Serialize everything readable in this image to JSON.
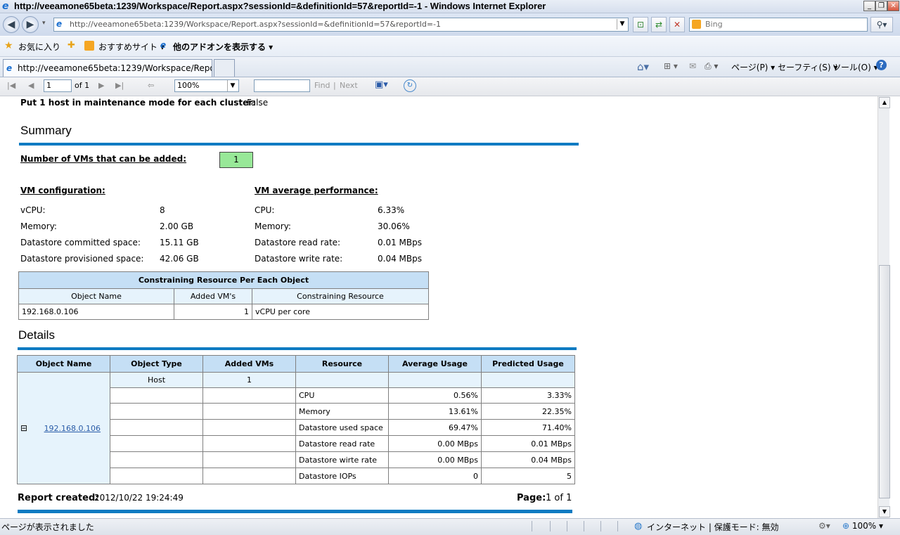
{
  "window": {
    "title": "http://veeamone65beta:1239/Workspace/Report.aspx?sessionId=&definitionId=57&reportId=-1 - Windows Internet Explorer",
    "min_label": "_",
    "max_label": "❐",
    "close_label": "✕"
  },
  "addressbar": {
    "url": "http://veeamone65beta:1239/Workspace/Report.aspx?sessionId=&definitionId=57&reportId=-1",
    "search_placeholder": "Bing"
  },
  "favorites": {
    "favorites_label": "お気に入り",
    "suggested_label": "おすすめサイト ▾",
    "addons_label": "他のアドオンを表示する ▾"
  },
  "tabs": {
    "active_label": "http://veeamone65beta:1239/Workspace/Report.as...",
    "page_menu": "ページ(P) ▾",
    "safety_menu": "セーフティ(S) ▾",
    "tools_menu": "ツール(O) ▾"
  },
  "report_toolbar": {
    "page_value": "1",
    "of_label": "of 1",
    "zoom_value": "100%",
    "find_label": "Find",
    "separator": "|",
    "next_label": "Next"
  },
  "report": {
    "maintenance_label": "Put 1 host in maintenance mode for each cluster:",
    "maintenance_value": "False",
    "summary_heading": "Summary",
    "vms_added_label": "Number of VMs that can be added:",
    "vms_added_value": "1",
    "vm_config_heading": "VM configuration:",
    "vm_perf_heading": "VM average performance:",
    "config": [
      {
        "label": "vCPU:",
        "value": "8"
      },
      {
        "label": "Memory:",
        "value": "2.00 GB"
      },
      {
        "label": "Datastore committed space:",
        "value": "15.11 GB"
      },
      {
        "label": "Datastore provisioned space:",
        "value": "42.06 GB"
      }
    ],
    "perf": [
      {
        "label": "CPU:",
        "value": "6.33%"
      },
      {
        "label": "Memory:",
        "value": "30.06%"
      },
      {
        "label": "Datastore read rate:",
        "value": "0.01 MBps"
      },
      {
        "label": "Datastore write rate:",
        "value": "0.04 MBps"
      }
    ],
    "constraining": {
      "title": "Constraining Resource Per Each Object",
      "headers": [
        "Object Name",
        "Added VM's",
        "Constraining Resource"
      ],
      "row": [
        "192.168.0.106",
        "1",
        "vCPU per core"
      ]
    },
    "details_heading": "Details",
    "details": {
      "headers": [
        "Object Name",
        "Object Type",
        "Added VMs",
        "Resource",
        "Average Usage",
        "Predicted Usage"
      ],
      "object_name": "192.168.0.106",
      "expand_label": "⊟",
      "host_row": {
        "type": "Host",
        "added": "1"
      },
      "rows": [
        {
          "resource": "CPU",
          "avg": "0.56%",
          "pred": "3.33%"
        },
        {
          "resource": "Memory",
          "avg": "13.61%",
          "pred": "22.35%"
        },
        {
          "resource": "Datastore used space",
          "avg": "69.47%",
          "pred": "71.40%"
        },
        {
          "resource": "Datastore read rate",
          "avg": "0.00 MBps",
          "pred": "0.01 MBps"
        },
        {
          "resource": "Datastore wirte rate",
          "avg": "0.00 MBps",
          "pred": "0.04 MBps"
        },
        {
          "resource": "Datastore IOPs",
          "avg": "0",
          "pred": "5"
        }
      ]
    },
    "footer_created_label": "Report created:",
    "footer_created_value": "2012/10/22 19:24:49",
    "footer_page_label": "Page:",
    "footer_page_value": "1 of 1"
  },
  "statusbar": {
    "left_text": "ページが表示されました",
    "zone_text": "インターネット | 保護モード: 無効",
    "zoom_text": "100%"
  },
  "colors": {
    "accent_bar": "#0d7bc2",
    "header_cell": "#c5dff5",
    "light_cell": "#e6f3fc",
    "green_badge": "#98e898"
  }
}
